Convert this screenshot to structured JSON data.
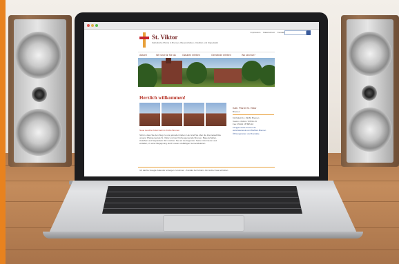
{
  "site": {
    "title": "St. Viktor",
    "tagline": "Katholische Pfarrei in Bremen, Bauerschaften, Ostuffeln und Stapelsfeld",
    "top_links": [
      "Impressum",
      "Datenschutz",
      "Kontakt"
    ],
    "nav": [
      "Aktuell",
      "Wir sind für Sie da",
      "Glauben erleben",
      "Gemeinde erleben",
      "Wo sind wir?"
    ],
    "heading": "Herzlich willkommen!",
    "photo_caption": "Neue Leuchte findet bald im Kirche Bremen",
    "body_text": "Schön, dass Sie den Weg zu uns gefunden haben. Hier sind Sie über die Internetauftritte unserer Pfarrgemeinde St. Viktor und der Kirchengemeinde Bremen, Bauerschaften, Ostuffeln und Stapelsfeld. Wir möchten Sie auf die folgenden Seiten informieren und einladen, zu einer Begegnung durch unsere vielfältigen Gemeindeleben.",
    "sidebar": {
      "title": "Kath. Pfarrei St. Viktor",
      "subtitle": "Bremen",
      "address": "Kirchplatz 11, 49163 Bremen",
      "phone": "Telefon: 05413 / 87895-15",
      "fax": "Fax: 05413 / 87895-16",
      "links": [
        "info@st-viktor-bremen.de",
        "www.facebook.com/StViktor.Bremen",
        "Öffnungszeiten und Kontakte"
      ]
    },
    "footer": "Ich dachte Google-Kalender anzeigen zu können - Kontakt bei Fehlern. Ein letzter Gast erhielten."
  },
  "colors": {
    "accent_red": "#b8372b",
    "accent_orange": "#e8a03a",
    "link_blue": "#3a5a9a",
    "side_bar": "#e8821e"
  }
}
